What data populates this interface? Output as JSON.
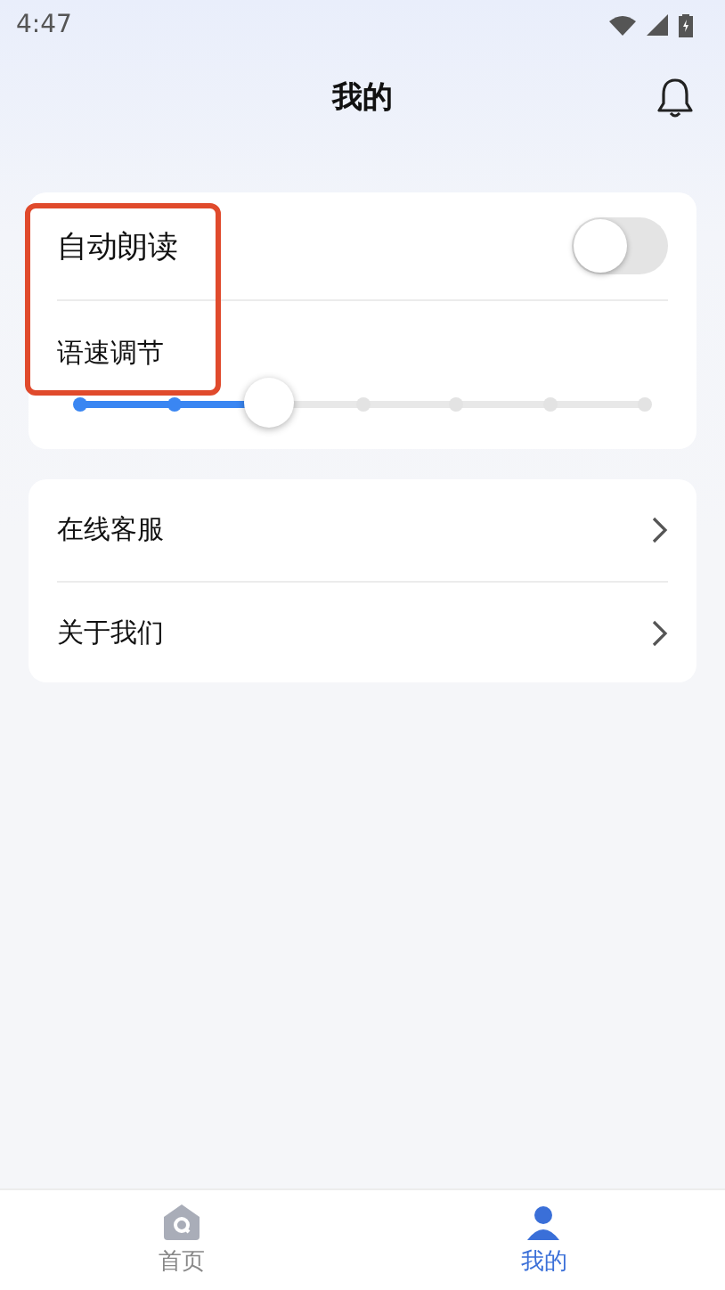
{
  "status_bar": {
    "time": "4:47"
  },
  "header": {
    "title": "我的"
  },
  "settings": {
    "auto_read": {
      "label": "自动朗读",
      "on": false
    },
    "speed": {
      "label": "语速调节",
      "level": 0.3333
    },
    "highlighted": true
  },
  "menu": [
    {
      "label": "在线客服"
    },
    {
      "label": "关于我们"
    }
  ],
  "bottom_nav": [
    {
      "label": "首页",
      "selected": false
    },
    {
      "label": "我的",
      "selected": true
    }
  ]
}
